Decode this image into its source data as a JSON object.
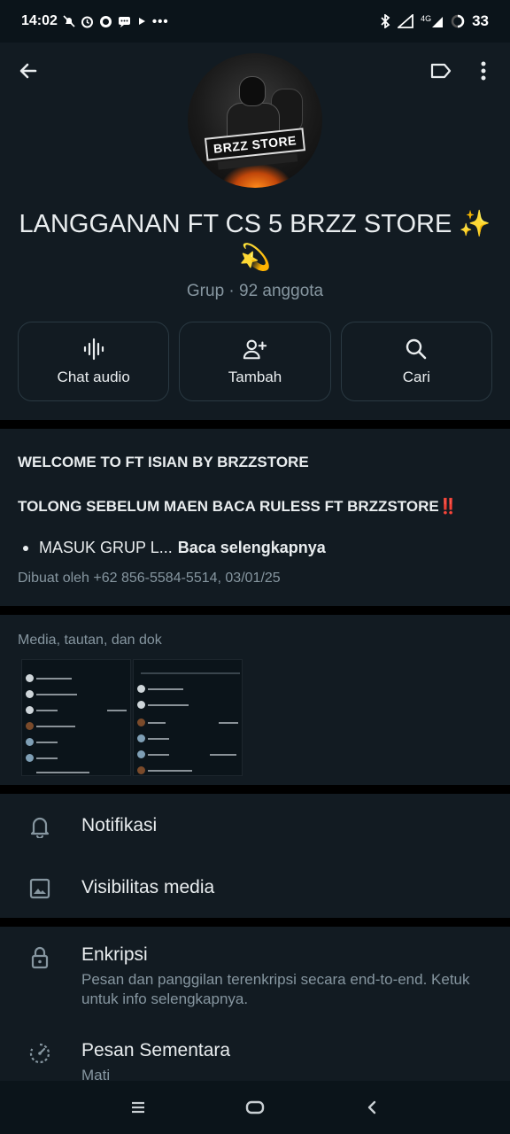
{
  "status_bar": {
    "time": "14:02",
    "left_icons": [
      "mute-icon",
      "alarm-icon",
      "whatsapp-icon",
      "chat-icon",
      "play-icon",
      "more-dots-icon"
    ],
    "right_icons": [
      "bluetooth-icon",
      "signal-icon",
      "network-4g-icon",
      "battery-icon"
    ],
    "network": "4G",
    "battery": "33"
  },
  "header": {
    "group_name": "LANGGANAN FT CS 5 BRZZ STORE ✨💫",
    "subtitle": "Grup · 92 anggota",
    "avatar_logo_text": "BRZZ STORE",
    "actions": [
      {
        "label": "Chat audio",
        "icon": "audio-waveform-icon"
      },
      {
        "label": "Tambah",
        "icon": "add-person-icon"
      },
      {
        "label": "Cari",
        "icon": "search-icon"
      }
    ]
  },
  "description": {
    "line1": "WELCOME TO FT ISIAN BY BRZZSTORE",
    "line2": "TOLONG SEBELUM MAEN BACA RULESS FT BRZZSTORE‼️",
    "bullet": "MASUK GRUP L...",
    "read_more": "Baca selengkapnya",
    "created_by": "Dibuat oleh +62 856-5584-5514, 03/01/25"
  },
  "media": {
    "title": "Media, tautan, dan dok"
  },
  "settings": {
    "notifications": "Notifikasi",
    "media_visibility": "Visibilitas media",
    "encryption_title": "Enkripsi",
    "encryption_sub": "Pesan dan panggilan terenkripsi secara end-to-end. Ketuk untuk info selengkapnya.",
    "disappearing_title": "Pesan Sementara",
    "disappearing_sub": "Mati"
  },
  "colors": {
    "background": "#121b22",
    "divider": "#000000",
    "text_primary": "#e9edef",
    "text_secondary": "#8696a0",
    "border": "#2a3942"
  }
}
